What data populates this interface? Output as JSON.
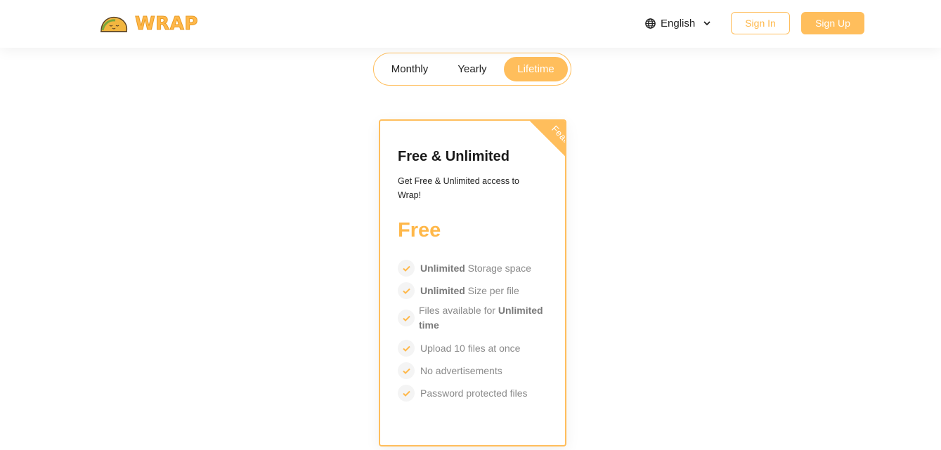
{
  "brand": {
    "name": "WRAP",
    "color": "#ffb84a"
  },
  "header": {
    "language": "English",
    "sign_in": "Sign In",
    "sign_up": "Sign Up"
  },
  "billing_toggle": {
    "options": [
      "Monthly",
      "Yearly",
      "Lifetime"
    ],
    "selected": "Lifetime"
  },
  "plan": {
    "ribbon": "Featured",
    "title": "Free & Unlimited",
    "description": "Get Free & Unlimited access to Wrap!",
    "price": "Free",
    "features": [
      {
        "bold": "Unlimited",
        "text": " Storage space"
      },
      {
        "bold": "Unlimited",
        "text": " Size per file"
      },
      {
        "text": "Files available for ",
        "bold_after": "Unlimited time"
      },
      {
        "text": "Upload 10 files at once"
      },
      {
        "text": "No advertisements"
      },
      {
        "text": "Password protected files"
      }
    ]
  },
  "colors": {
    "accent": "#ffbe5c",
    "accent_text": "#ffb84a"
  },
  "icons": [
    "taco-logo-icon",
    "globe-icon",
    "chevron-down-icon",
    "check-icon"
  ]
}
